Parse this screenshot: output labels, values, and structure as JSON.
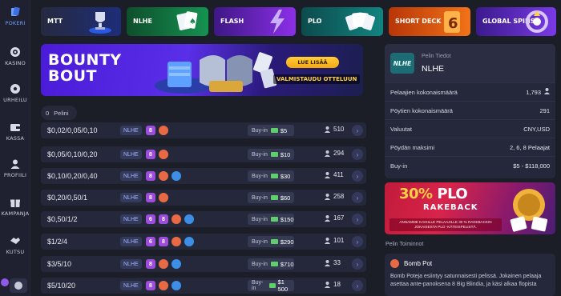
{
  "sidebar": {
    "items": [
      {
        "label": "POKERI",
        "icon": "cards-icon",
        "active": true
      },
      {
        "label": "KASINO",
        "icon": "roulette-icon"
      },
      {
        "label": "URHEILU",
        "icon": "soccer-ball-icon"
      },
      {
        "label": "KASSA",
        "icon": "wallet-icon"
      },
      {
        "label": "PROFIILI",
        "icon": "user-icon"
      },
      {
        "label": "KAMPANJA",
        "icon": "gift-icon"
      },
      {
        "label": "KUTSU",
        "icon": "handshake-icon"
      }
    ]
  },
  "categories": [
    {
      "label": "MTT",
      "color_from": "#2a2d42",
      "color_to": "#1a2f7a"
    },
    {
      "label": "NLHE",
      "color_from": "#0e4f2c",
      "color_to": "#138a4a"
    },
    {
      "label": "FLASH",
      "color_from": "#4a1b8a",
      "color_to": "#8a2be2"
    },
    {
      "label": "PLO",
      "color_from": "#0d5656",
      "color_to": "#0f7d7a"
    },
    {
      "label": "SHORT\nDECK",
      "color_from": "#c2410c",
      "color_to": "#f97316"
    },
    {
      "label": "GLOBAL\nSPINS",
      "color_from": "#3b1a8a",
      "color_to": "#7c3aed"
    }
  ],
  "banner": {
    "title": "BOUNTY\nBOUT",
    "button": "LUE LISÄÄ",
    "tagline": "VALMISTAUDU OTTELUUN"
  },
  "list_header": {
    "count": "0",
    "label": "Pelini"
  },
  "buyin_label": "Buy-in",
  "tables": [
    {
      "stakes": "$0,02/0,05/0,10",
      "game": "NLHE",
      "badges": [
        "8",
        "bomb"
      ],
      "buyin": "$5",
      "players": "510"
    },
    {
      "stakes": "$0,05/0,10/0,20",
      "game": "NLHE",
      "badges": [
        "8",
        "bomb"
      ],
      "buyin": "$10",
      "players": "294"
    },
    {
      "stakes": "$0,10/0,20/0,40",
      "game": "NLHE",
      "badges": [
        "8",
        "bomb",
        "chip"
      ],
      "buyin": "$30",
      "players": "411"
    },
    {
      "stakes": "$0,20/0,50/1",
      "game": "NLHE",
      "badges": [
        "8",
        "bomb"
      ],
      "buyin": "$60",
      "players": "258"
    },
    {
      "stakes": "$0,50/1/2",
      "game": "NLHE",
      "badges": [
        "6",
        "8",
        "bomb",
        "chip"
      ],
      "buyin": "$150",
      "players": "167"
    },
    {
      "stakes": "$1/2/4",
      "game": "NLHE",
      "badges": [
        "6",
        "8",
        "bomb",
        "chip"
      ],
      "buyin": "$290",
      "players": "101"
    },
    {
      "stakes": "$3/5/10",
      "game": "NLHE",
      "badges": [
        "8",
        "bomb",
        "chip"
      ],
      "buyin": "$710",
      "players": "33"
    },
    {
      "stakes": "$5/10/20",
      "game": "NLHE",
      "badges": [
        "8",
        "bomb",
        "chip"
      ],
      "buyin": "$1 500",
      "players": "18"
    }
  ],
  "info": {
    "logo_text": "NLHE",
    "subtitle": "Pelin Tiedot",
    "name": "NLHE",
    "rows": [
      {
        "k": "Pelaajien kokonaismäärä",
        "v": "1,793"
      },
      {
        "k": "Pöytien kokonaismäärä",
        "v": "291"
      },
      {
        "k": "Valuutat",
        "v": "CNY,USD"
      },
      {
        "k": "Pöydän maksimi",
        "v": "2, 6, 8 Pelaajat"
      },
      {
        "k": "Buy-in",
        "v": "$5 - $118,000"
      }
    ]
  },
  "promo": {
    "pct": "30%",
    "plo": "PLO",
    "sub": "RAKEBACK",
    "small": "ANNAMME KAIKILLE PELAAJILLE 30 % RAKEBACKIN JOKAISESTA PLO -KÄTEISPELISTÄ."
  },
  "features": {
    "title": "Pelin Toiminnot",
    "bomb_title": "Bomb Pot",
    "bomb_desc": "Bomb Poteja esiintyy satunnaisesti pelissä. Jokainen pelaaja asettaa ante-panoksena 8 Big Blindia, ja käsi alkaa flopista"
  }
}
